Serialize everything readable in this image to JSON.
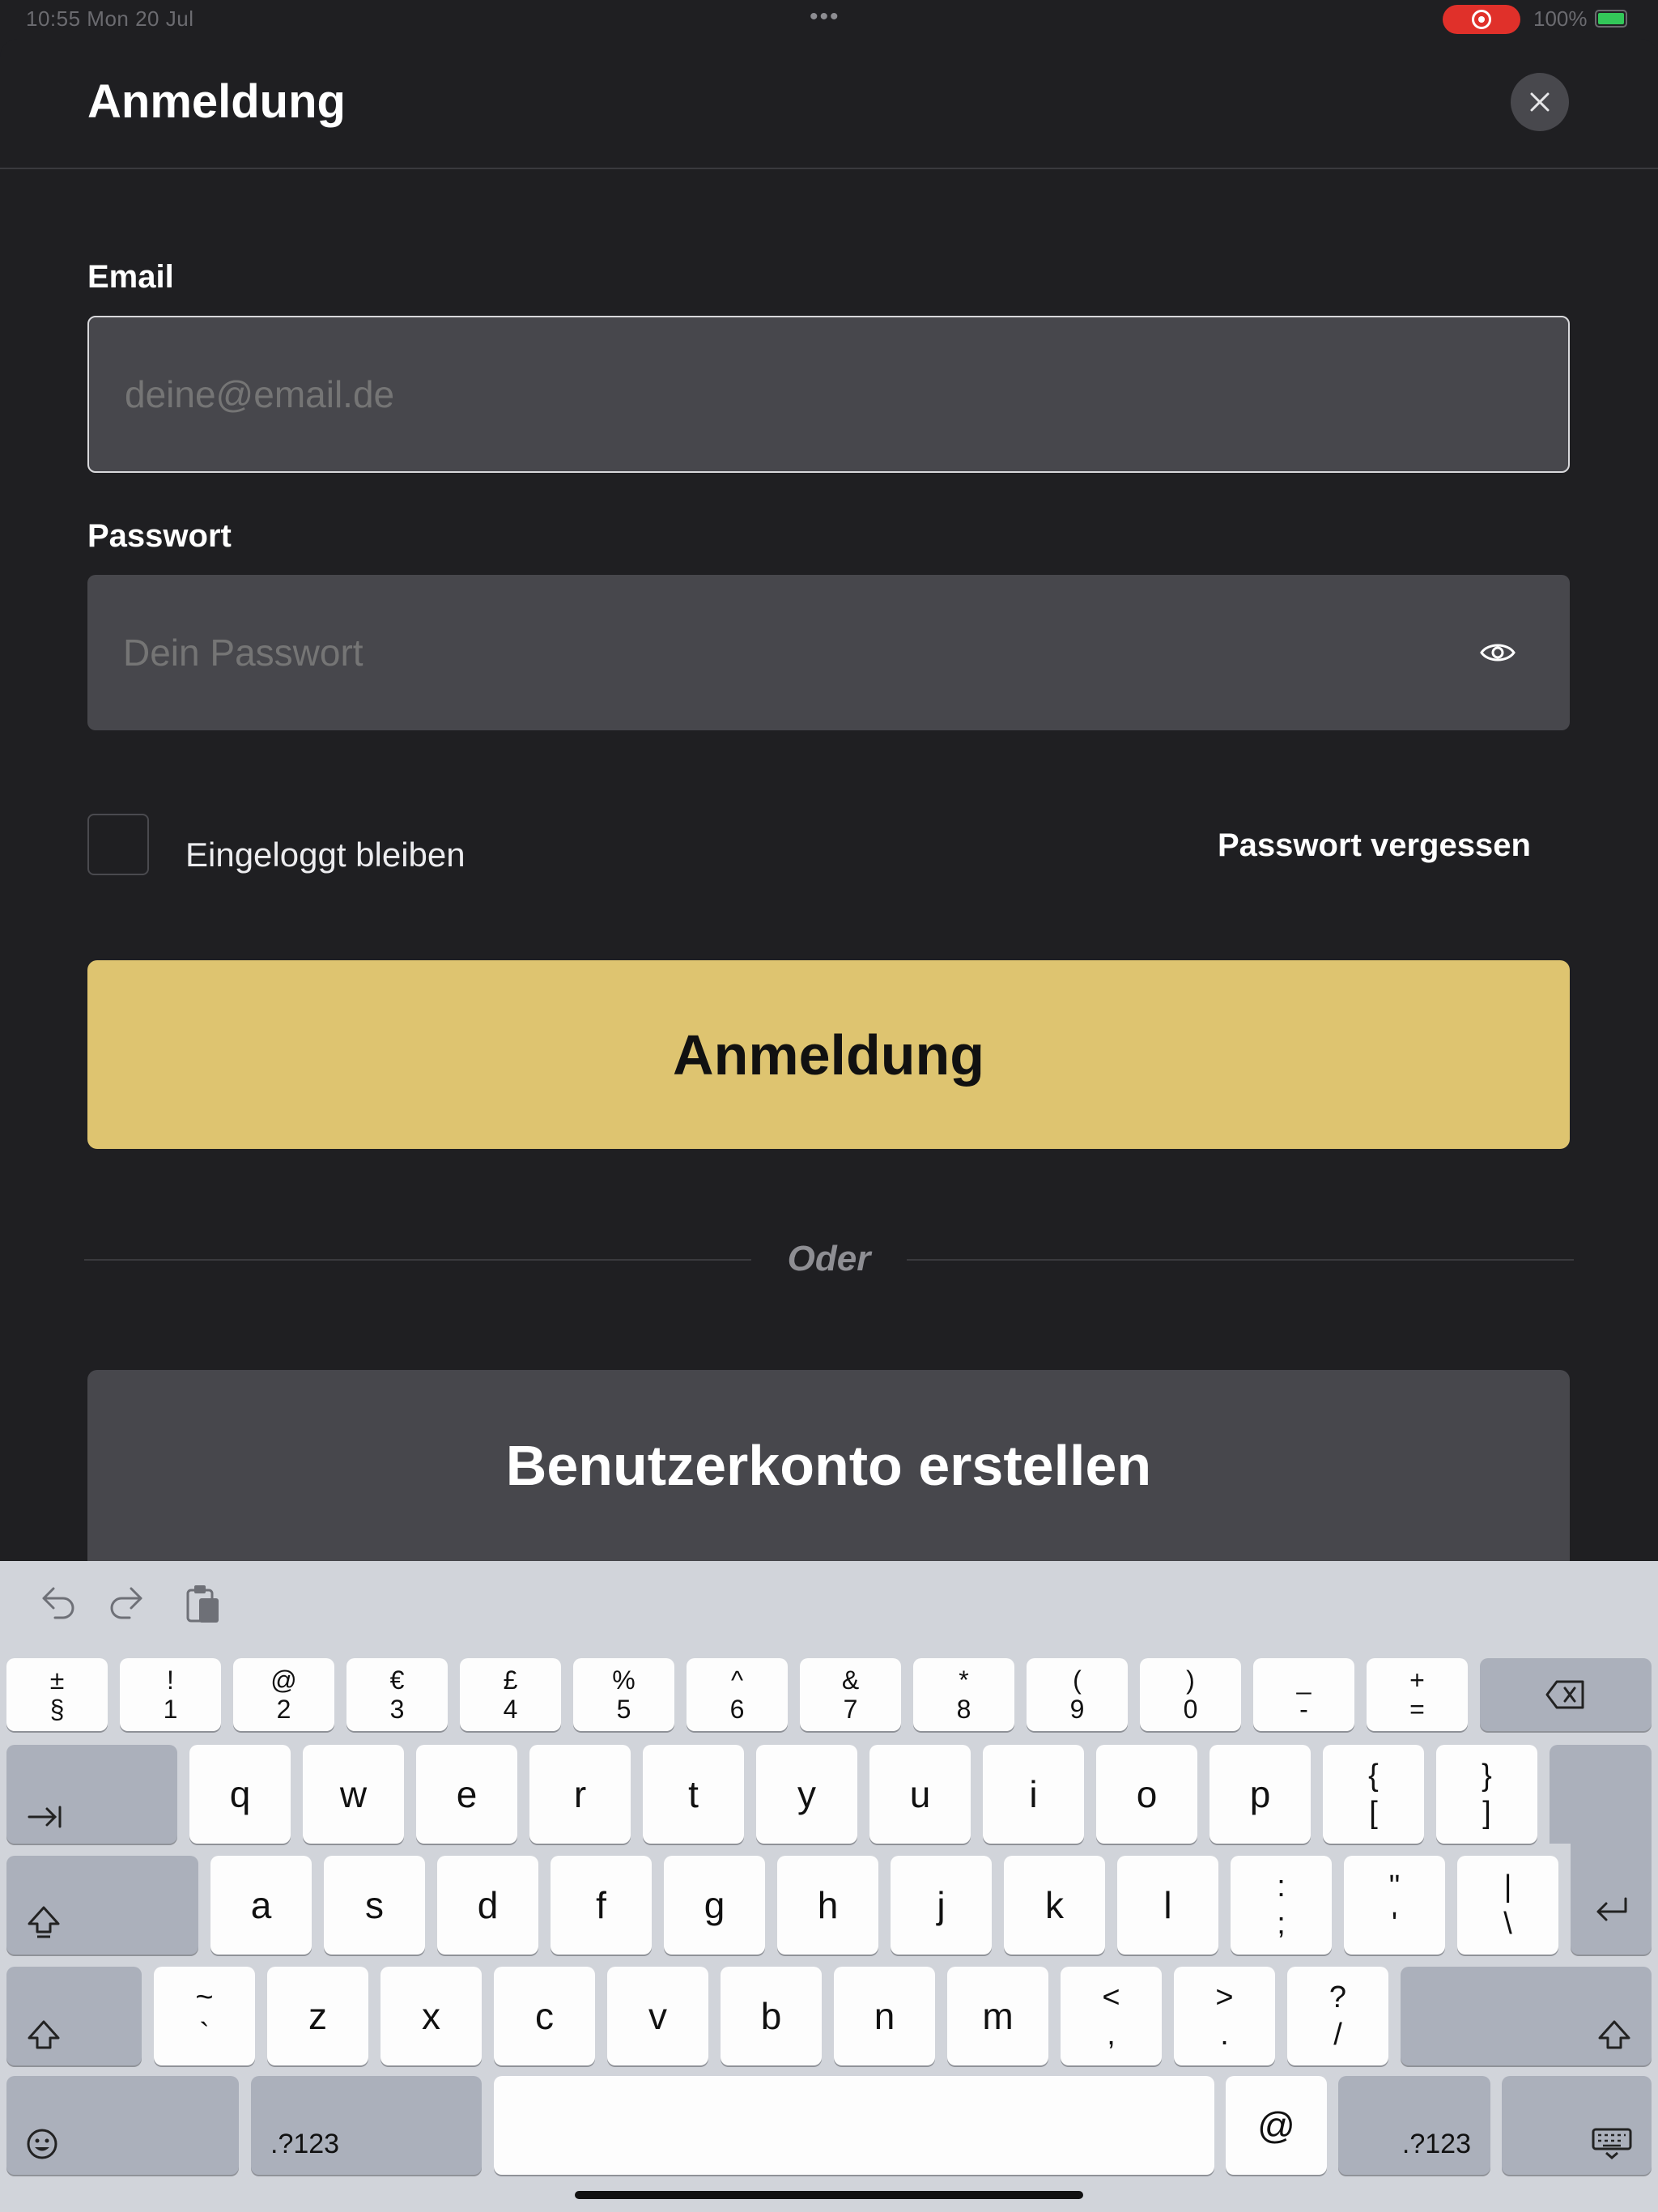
{
  "status_bar": {
    "time": "10:55  Mon 20 Jul",
    "multitask_dots": "•••",
    "battery_percent": "100%",
    "record_indicator_color": "#e0302a"
  },
  "header": {
    "title": "Anmeldung",
    "close_icon": "close-icon"
  },
  "form": {
    "email_label": "Email",
    "email_placeholder": "deine@email.de",
    "email_value": "",
    "password_label": "Passwort",
    "password_placeholder": "Dein Passwort",
    "password_value": "",
    "password_toggle_icon": "eye-icon",
    "remember_label": "Eingeloggt bleiben",
    "remember_checked": false,
    "forgot_label": "Passwort vergessen",
    "submit_label": "Anmeldung",
    "divider_text": "Oder",
    "register_label": "Benutzerkonto erstellen"
  },
  "colors": {
    "accent": "#dec470",
    "background": "#1f1f22",
    "field": "#47474c"
  },
  "keyboard": {
    "toolbar_icons": [
      "undo-icon",
      "redo-icon",
      "paste-icon"
    ],
    "row1": [
      {
        "top": "±",
        "bottom": "§"
      },
      {
        "top": "!",
        "bottom": "1"
      },
      {
        "top": "@",
        "bottom": "2"
      },
      {
        "top": "€",
        "bottom": "3"
      },
      {
        "top": "£",
        "bottom": "4"
      },
      {
        "top": "%",
        "bottom": "5"
      },
      {
        "top": "^",
        "bottom": "6"
      },
      {
        "top": "&",
        "bottom": "7"
      },
      {
        "top": "*",
        "bottom": "8"
      },
      {
        "top": "(",
        "bottom": "9"
      },
      {
        "top": ")",
        "bottom": "0"
      },
      {
        "top": "_",
        "bottom": "-"
      },
      {
        "top": "+",
        "bottom": "="
      }
    ],
    "row2": [
      "q",
      "w",
      "e",
      "r",
      "t",
      "y",
      "u",
      "i",
      "o",
      "p"
    ],
    "row2_symbols": [
      {
        "top": "{",
        "bottom": "["
      },
      {
        "top": "}",
        "bottom": "]"
      }
    ],
    "row3": [
      "a",
      "s",
      "d",
      "f",
      "g",
      "h",
      "j",
      "k",
      "l"
    ],
    "row3_symbols": [
      {
        "top": ":",
        "bottom": ";"
      },
      {
        "top": "\"",
        "bottom": "'"
      },
      {
        "top": "|",
        "bottom": "\\"
      }
    ],
    "row4_symbol_first": {
      "top": "~",
      "bottom": "`"
    },
    "row4": [
      "z",
      "x",
      "c",
      "v",
      "b",
      "n",
      "m"
    ],
    "row4_symbols": [
      {
        "top": "<",
        "bottom": ","
      },
      {
        "top": ">",
        "bottom": "."
      },
      {
        "top": "?",
        "bottom": "/"
      }
    ],
    "numbers_label": ".?123",
    "at_label": "@",
    "space_label": ""
  }
}
